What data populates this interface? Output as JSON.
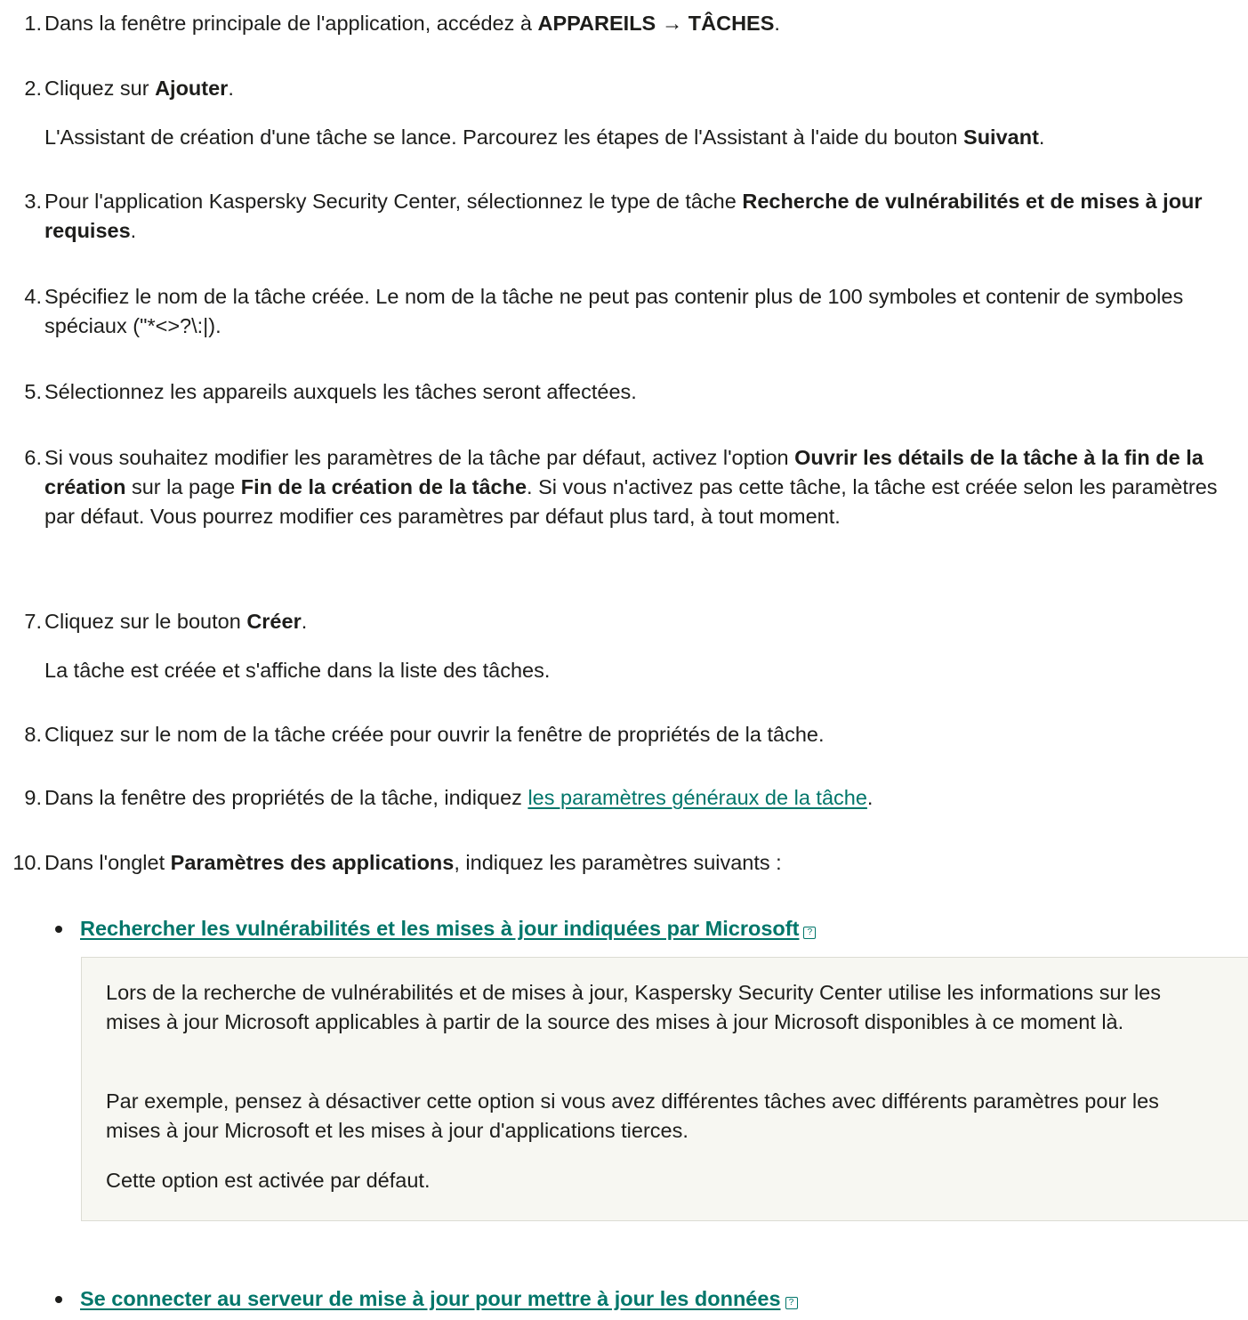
{
  "steps": [
    {
      "num": "1.",
      "parts": [
        {
          "t": "Dans la fenêtre principale de l'application, accédez à "
        },
        {
          "t": "APPAREILS → TÂCHES",
          "b": true
        },
        {
          "t": "."
        }
      ]
    },
    {
      "num": "2.",
      "parts": [
        {
          "t": "Cliquez sur "
        },
        {
          "t": "Ajouter",
          "b": true
        },
        {
          "t": "."
        }
      ],
      "note": [
        {
          "t": "L'Assistant de création d'une tâche se lance. Parcourez les étapes de l'Assistant à l'aide du bouton "
        },
        {
          "t": "Suivant",
          "b": true
        },
        {
          "t": "."
        }
      ]
    },
    {
      "num": "3.",
      "parts": [
        {
          "t": "Pour l'application Kaspersky Security Center, sélectionnez le type de tâche "
        },
        {
          "t": "Recherche de vulnérabilités et de mises à jour requises",
          "b": true
        },
        {
          "t": "."
        }
      ]
    },
    {
      "num": "4.",
      "parts": [
        {
          "t": "Spécifiez le nom de la tâche créée. Le nom de la tâche ne peut pas contenir plus de 100 symboles et contenir de symboles spéciaux (\"*<>?\\:|)."
        }
      ]
    },
    {
      "num": "5.",
      "parts": [
        {
          "t": "Sélectionnez les appareils auxquels les tâches seront affectées."
        }
      ]
    },
    {
      "num": "6.",
      "parts": [
        {
          "t": "Si vous souhaitez modifier les paramètres de la tâche par défaut, activez l'option "
        },
        {
          "t": "Ouvrir les détails de la tâche à la fin de la création",
          "b": true
        },
        {
          "t": " sur la page "
        },
        {
          "t": "Fin de la création de la tâche",
          "b": true
        },
        {
          "t": ". Si vous n'activez pas cette tâche, la tâche est créée selon les paramètres par défaut. Vous pourrez modifier ces paramètres par défaut plus tard, à tout moment."
        }
      ]
    },
    {
      "num": "7.",
      "parts": [
        {
          "t": "Cliquez sur le bouton "
        },
        {
          "t": "Créer",
          "b": true
        },
        {
          "t": "."
        }
      ],
      "note": [
        {
          "t": "La tâche est créée et s'affiche dans la liste des tâches."
        }
      ]
    },
    {
      "num": "8.",
      "parts": [
        {
          "t": "Cliquez sur le nom de la tâche créée pour ouvrir la fenêtre de propriétés de la tâche."
        }
      ]
    },
    {
      "num": "9.",
      "parts": [
        {
          "t": "Dans la fenêtre des propriétés de la tâche, indiquez "
        },
        {
          "t": "les paramètres généraux de la tâche",
          "link": true
        },
        {
          "t": "."
        }
      ]
    },
    {
      "num": "10.",
      "parts": [
        {
          "t": "Dans l'onglet "
        },
        {
          "t": "Paramètres des applications",
          "b": true
        },
        {
          "t": ", indiquez les paramètres suivants :"
        }
      ]
    }
  ],
  "options": [
    {
      "label": "Rechercher les vulnérabilités et les mises à jour indiquées par Microsoft",
      "help_icon": "?",
      "expanded": true,
      "paragraphs": [
        "Lors de la recherche de vulnérabilités et de mises à jour, Kaspersky Security Center utilise les informations sur les mises à jour Microsoft applicables à partir de la source des mises à jour Microsoft disponibles à ce moment là.",
        "Par exemple, pensez à désactiver cette option si vous avez différentes tâches avec différents paramètres pour les mises à jour Microsoft et les mises à jour d'applications tierces.",
        "Cette option est activée par défaut."
      ]
    },
    {
      "label": "Se connecter au serveur de mise à jour pour mettre à jour les données",
      "help_icon": "?",
      "expanded": false
    }
  ],
  "colors": {
    "link": "#00766a",
    "text": "#1d1d1b",
    "panel_bg": "#f7f7f2"
  }
}
